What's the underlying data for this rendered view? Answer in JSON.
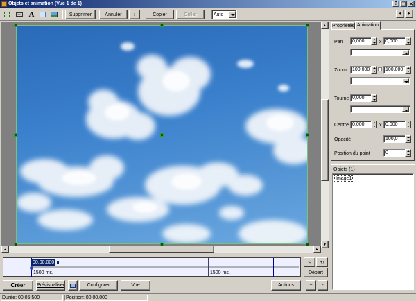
{
  "window": {
    "title": "Objets et animation  (Vue 1 de 1)"
  },
  "toolbar": {
    "delete": "Supprimer",
    "undo": "Annuler",
    "redo_arrow": "›",
    "copy": "Copier",
    "paste": "Coller",
    "mode_value": "Auto",
    "prev_arrow": "◄",
    "next_arrow": "►"
  },
  "panel": {
    "tabs": [
      "Propriétés",
      "Animation"
    ],
    "active_tab": 1,
    "pan_label": "Pan",
    "pan_x": "0,000",
    "pan_y": "0,000",
    "x_symbol": "x",
    "zoom_label": "Zoom",
    "zoom_x": "100,000",
    "zoom_y": "100,000",
    "rotate_label": "Tourne",
    "rotate_value": "0,000",
    "center_label": "Centre",
    "center_x": "0,000",
    "center_y": "0,000",
    "opacity_label": "Opacité",
    "opacity_value": "100,0",
    "point_label": "Position du point",
    "point_value": "0"
  },
  "objects": {
    "header": "Objets (1)",
    "items": [
      "Image1"
    ]
  },
  "timeline": {
    "current_time": "00:00.000",
    "segment1_duration": "1500 ms.",
    "segment2_duration": "1500 ms.",
    "prev_btn": "<",
    "next_btn": "+›",
    "depart_btn": "Départ"
  },
  "bottom": {
    "create": "Créer",
    "preview": "Prévisualiser",
    "configure": "Configurer",
    "view": "Vue",
    "actions": "Actions",
    "plus": "+",
    "minus": "-"
  },
  "status": {
    "duration": "Durée:  00:05.500",
    "position": "Position:  00:00.000"
  },
  "colors": {
    "titlebar_start": "#0a246a",
    "titlebar_end": "#a6caf0",
    "selection": "#0a246a",
    "timeline_bg": "#eef0ff",
    "handle": "#0a5a0a"
  }
}
